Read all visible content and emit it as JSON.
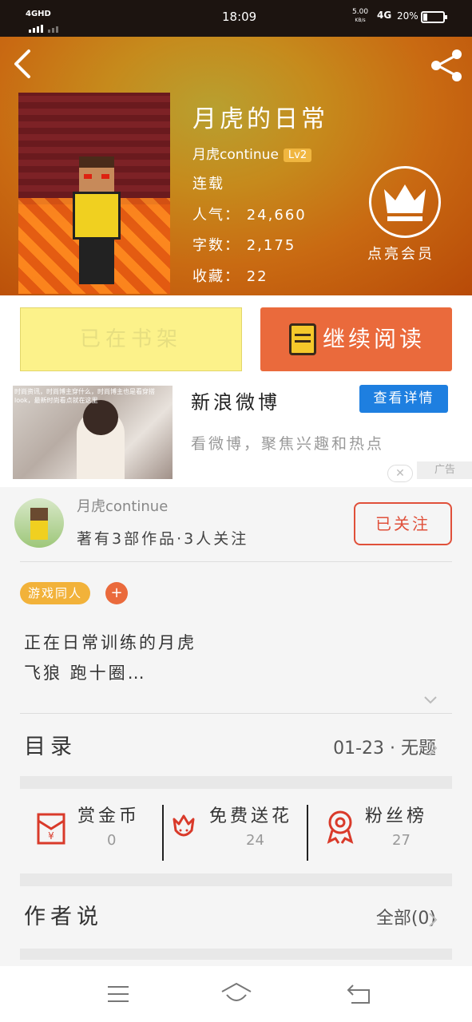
{
  "status_bar": {
    "network": "4GHD",
    "time": "18:09",
    "speed": "5.00",
    "speed_unit": "KB/s",
    "signal": "4G",
    "battery": "20%"
  },
  "book": {
    "title": "月虎的日常",
    "author": "月虎continue",
    "level": "Lv2",
    "status": "连载",
    "popularity_label": "人气：",
    "popularity": "24,660",
    "words_label": "字数：",
    "words": "2,175",
    "favorites_label": "收藏：",
    "favorites": "22",
    "vip_label": "点亮会员"
  },
  "actions": {
    "shelf_label": "已在书架",
    "read_label": "继续阅读"
  },
  "ad": {
    "image_caption": "时尚资讯，时尚博主穿什么，时尚博主也是看穿搭look，最新时尚看点就在这里",
    "title": "新浪微博",
    "button": "查看详情",
    "subtitle": "看微博，聚焦兴趣和热点",
    "tag": "广告",
    "close": "✕"
  },
  "author_card": {
    "name": "月虎continue",
    "stats": "著有3部作品·3人关注",
    "follow_label": "已关注"
  },
  "tags": [
    "游戏同人"
  ],
  "tag_add": "+",
  "description": [
    "正在日常训练的月虎",
    "飞狼 跑十圈…"
  ],
  "catalog": {
    "label": "目录",
    "latest": "01-23 · 无题"
  },
  "stats": [
    {
      "label": "赏金币",
      "value": "0"
    },
    {
      "label": "免费送花",
      "value": "24"
    },
    {
      "label": "粉丝榜",
      "value": "27"
    }
  ],
  "author_says": {
    "label": "作者说",
    "count": "全部(0)"
  },
  "colors": {
    "accent": "#ea6a3c",
    "follow": "#e0503a",
    "ad_button": "#1e7fe0",
    "tag": "#f2b23a"
  }
}
